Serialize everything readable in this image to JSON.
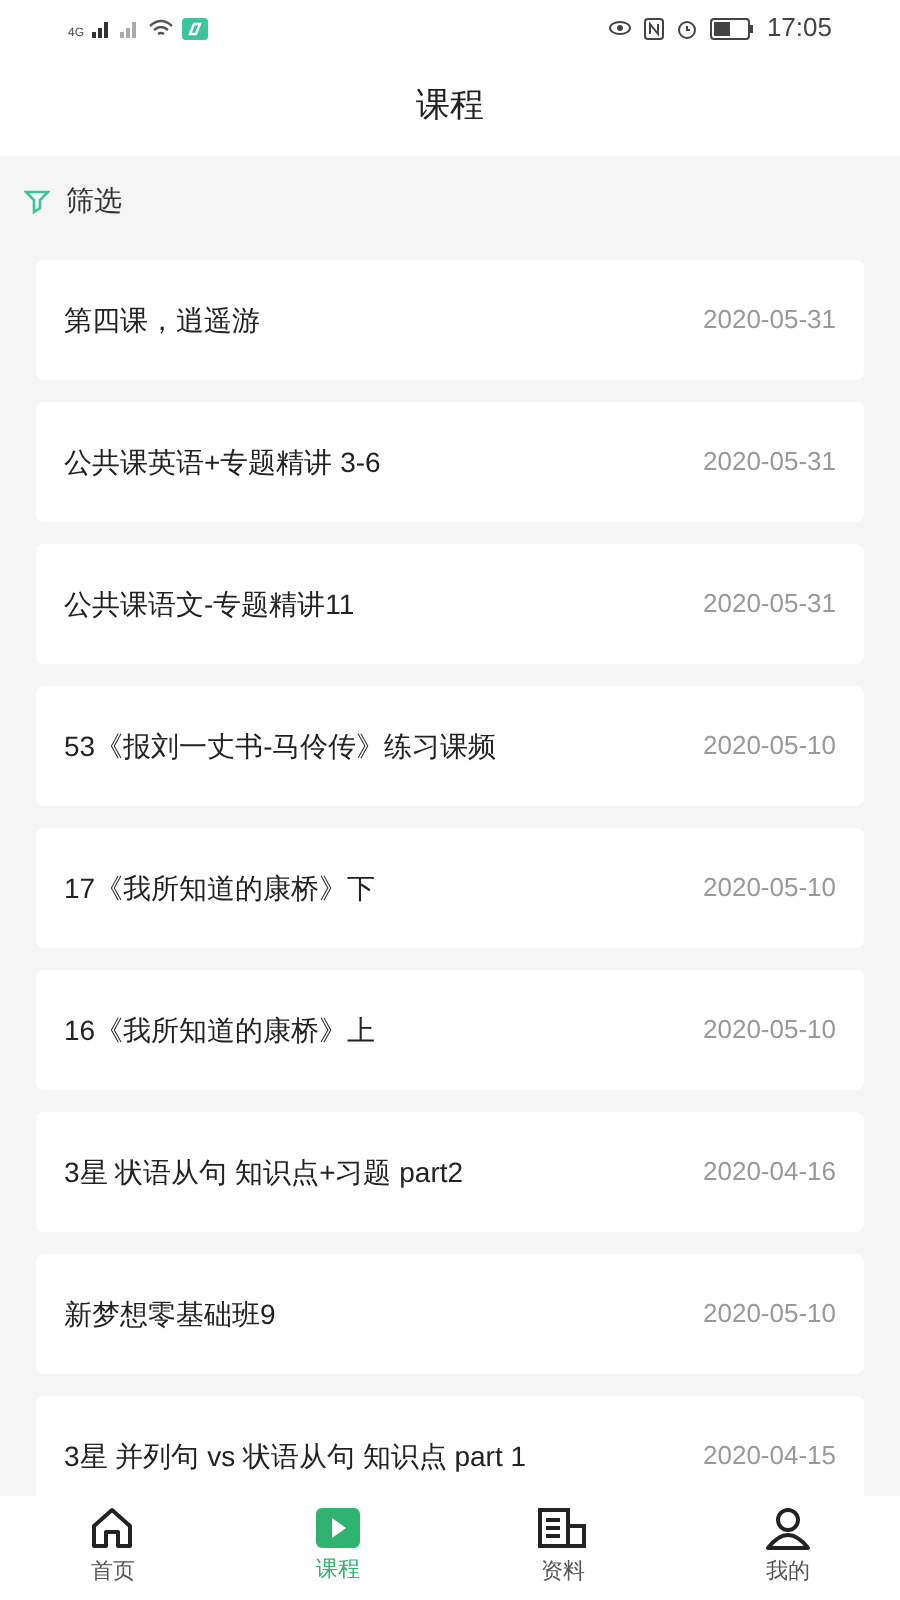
{
  "status_bar": {
    "time": "17:05",
    "network": "4G"
  },
  "header": {
    "title": "课程"
  },
  "filter": {
    "label": "筛选"
  },
  "courses": [
    {
      "title": "第四课，逍遥游",
      "date": "2020-05-31"
    },
    {
      "title": "公共课英语+专题精讲 3-6",
      "date": "2020-05-31"
    },
    {
      "title": "公共课语文-专题精讲11",
      "date": "2020-05-31"
    },
    {
      "title": "53《报刘一丈书-马伶传》练习课频",
      "date": "2020-05-10"
    },
    {
      "title": "17《我所知道的康桥》下",
      "date": "2020-05-10"
    },
    {
      "title": "16《我所知道的康桥》上",
      "date": "2020-05-10"
    },
    {
      "title": "3星 状语从句 知识点+习题 part2",
      "date": "2020-04-16"
    },
    {
      "title": "新梦想零基础班9",
      "date": "2020-05-10"
    },
    {
      "title": "3星 并列句 vs 状语从句 知识点 part 1",
      "date": "2020-04-15"
    }
  ],
  "tabs": [
    {
      "kind": "home",
      "label": "首页",
      "selected": false
    },
    {
      "kind": "course",
      "label": "课程",
      "selected": true
    },
    {
      "kind": "docs",
      "label": "资料",
      "selected": false
    },
    {
      "kind": "me",
      "label": "我的",
      "selected": false
    }
  ]
}
